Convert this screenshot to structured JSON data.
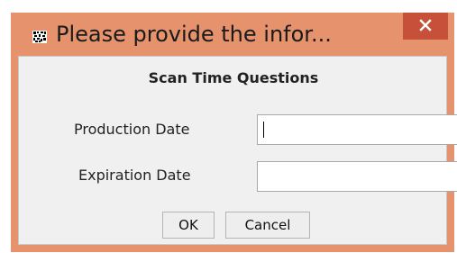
{
  "window": {
    "title": "Please provide the infor...",
    "close_label": "×"
  },
  "dialog": {
    "heading": "Scan Time Questions",
    "fields": [
      {
        "label": "Production Date",
        "value": "",
        "placeholder": ""
      },
      {
        "label": "Expiration Date",
        "value": "",
        "placeholder": ""
      }
    ],
    "buttons": {
      "ok": "OK",
      "cancel": "Cancel"
    }
  },
  "colors": {
    "titlebar": "#e6926d",
    "close": "#c7503a",
    "client": "#f0f0f0"
  },
  "icons": {
    "app": "java-app-icon",
    "close": "close-icon"
  }
}
